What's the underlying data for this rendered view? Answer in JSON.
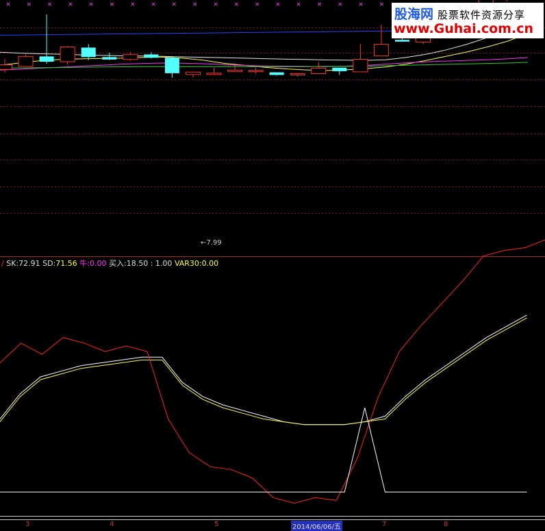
{
  "watermark": {
    "logo": "股海网",
    "slogan": "股票软件资源分享",
    "url": "www.Guhai.com.cn"
  },
  "legend": {
    "marker": "/",
    "sk_label": "SK:",
    "sk_value": "72.91",
    "sd_label": "SD:",
    "sd_value": "71.56",
    "niu_label": "牛:",
    "niu_value": "0.00",
    "buy_label": "买入:",
    "buy_value": "18.50",
    "sep_value": ":  1.00",
    "var_label": "VAR30:",
    "var_value": "0.00"
  },
  "price_low_label": "7.99",
  "x_labels": [
    "3",
    "4",
    "5",
    "2014/06/06/五",
    "7",
    "8"
  ],
  "colors": {
    "up": "#ff3232",
    "down": "#54ffff",
    "ma_white": "#e8e8e8",
    "ma_yellow": "#ffff33",
    "ma_magenta": "#ff33ff",
    "ma_green": "#33cc33",
    "ma_blue": "#2244ff",
    "grid": "#8b1a1a",
    "rsv": "#ff2020"
  },
  "chart_data": [
    {
      "type": "candlestick",
      "series": [
        {
          "name": "K",
          "ohlc": [
            [
              8.36,
              8.84,
              8.22,
              8.57
            ],
            [
              8.5,
              9.05,
              8.48,
              8.95
            ],
            [
              8.95,
              10.85,
              8.62,
              8.71
            ],
            [
              8.71,
              9.42,
              8.58,
              9.38
            ],
            [
              9.35,
              9.51,
              8.78,
              8.92
            ],
            [
              8.92,
              9.12,
              8.79,
              8.81
            ],
            [
              8.81,
              9.16,
              8.75,
              9.03
            ],
            [
              9.04,
              9.14,
              8.86,
              8.89
            ],
            [
              8.89,
              8.93,
              7.99,
              8.19
            ],
            [
              8.13,
              8.24,
              7.99,
              8.24
            ],
            [
              8.18,
              8.44,
              8.14,
              8.19
            ],
            [
              8.28,
              8.55,
              8.26,
              8.33
            ],
            [
              8.28,
              8.44,
              8.17,
              8.32
            ],
            [
              8.23,
              8.23,
              8.08,
              8.11
            ],
            [
              8.13,
              8.18,
              8.04,
              8.17
            ],
            [
              8.17,
              8.7,
              8.19,
              8.42
            ],
            [
              8.44,
              8.44,
              8.11,
              8.28
            ],
            [
              8.25,
              9.52,
              8.24,
              8.82
            ],
            [
              8.97,
              10.4,
              8.98,
              9.5
            ],
            [
              9.7,
              10.5,
              9.63,
              9.62
            ],
            [
              9.6,
              11.1,
              9.5,
              10.4
            ],
            [
              10.3,
              10.45,
              10.32,
              10.36
            ],
            [
              10.55,
              10.95,
              10.29,
              10.77
            ],
            [
              10.76,
              11.69,
              10.83,
              11.56
            ],
            [
              11.66,
              12.35,
              11.44,
              11.96
            ],
            [
              12.14,
              12.82,
              11.72,
              12.66
            ]
          ]
        }
      ],
      "moving_averages": [
        {
          "name": "white",
          "values": [
            9.14,
            9.1,
            9.07,
            9.05,
            9.02,
            9.0,
            8.98,
            8.97,
            8.95,
            8.93,
            8.91,
            8.89,
            8.87,
            8.85,
            8.83,
            8.81,
            8.79,
            8.78,
            8.77,
            8.8,
            8.9,
            9.05,
            9.25,
            9.5,
            9.8,
            10.1,
            10.55
          ]
        },
        {
          "name": "yellow",
          "values": [
            8.55,
            8.66,
            8.76,
            8.81,
            8.84,
            8.86,
            8.87,
            8.9,
            8.92,
            8.87,
            8.78,
            8.64,
            8.55,
            8.46,
            8.39,
            8.34,
            8.31,
            8.34,
            8.4,
            8.47,
            8.6,
            8.77,
            8.96,
            9.15,
            9.38,
            9.64,
            9.99
          ]
        },
        {
          "name": "magenta",
          "values": [
            8.33,
            8.37,
            8.42,
            8.46,
            8.51,
            8.55,
            8.6,
            8.63,
            8.65,
            8.64,
            8.62,
            8.58,
            8.54,
            8.52,
            8.51,
            8.5,
            8.49,
            8.51,
            8.54,
            8.6,
            8.66,
            8.71,
            8.74,
            8.77,
            8.8,
            8.84,
            8.9
          ]
        },
        {
          "name": "green",
          "values": [
            8.42,
            8.43,
            8.44,
            8.45,
            8.46,
            8.47,
            8.48,
            8.49,
            8.49,
            8.49,
            8.49,
            8.49,
            8.49,
            8.49,
            8.49,
            8.49,
            8.5,
            8.5,
            8.51,
            8.53,
            8.55,
            8.57,
            8.59,
            8.61,
            8.63,
            8.65,
            8.68
          ]
        },
        {
          "name": "blue",
          "values": [
            9.91,
            9.92,
            9.93,
            9.94,
            9.95,
            9.96,
            9.97,
            9.98,
            9.99,
            10.0,
            10.01,
            10.02,
            10.03,
            10.04,
            10.05,
            10.06,
            10.07,
            10.08,
            10.09,
            10.1,
            10.11,
            10.12,
            10.13,
            10.14,
            10.15,
            10.16,
            10.17
          ]
        }
      ],
      "low_annotation": 7.99
    },
    {
      "type": "line",
      "x": [
        0,
        1,
        2,
        3,
        4,
        5,
        6,
        7,
        8,
        9,
        10,
        11,
        12,
        13,
        14,
        15,
        16,
        17,
        18,
        19,
        20,
        21,
        22,
        23,
        24,
        25,
        26
      ],
      "series": [
        {
          "name": "SK",
          "values": [
            55,
            46,
            40,
            38,
            36,
            35,
            34,
            33,
            33,
            42,
            47,
            50,
            52,
            54,
            56,
            57,
            57,
            57,
            56,
            54,
            47,
            41,
            36,
            31,
            26,
            22,
            18
          ]
        },
        {
          "name": "SD",
          "values": [
            56,
            47,
            41,
            39,
            37,
            36,
            35,
            34,
            34,
            43,
            48,
            51,
            53,
            55,
            56,
            57,
            57,
            57,
            56,
            55,
            48,
            42,
            37,
            32,
            27,
            23,
            19
          ]
        },
        {
          "name": "RSV",
          "values": [
            35,
            28,
            32,
            26,
            28,
            31,
            29,
            31,
            55,
            67,
            72,
            73,
            76,
            83,
            85,
            83,
            84,
            69,
            47,
            31,
            22,
            14,
            6,
            -3,
            -5,
            -6,
            -9
          ]
        },
        {
          "name": "买入",
          "values": [
            81,
            81,
            81,
            81,
            81,
            81,
            81,
            81,
            81,
            81,
            81,
            81,
            81,
            81,
            81,
            81,
            81,
            81,
            51,
            81,
            81,
            81,
            81,
            81,
            81,
            81,
            81
          ]
        }
      ]
    }
  ]
}
